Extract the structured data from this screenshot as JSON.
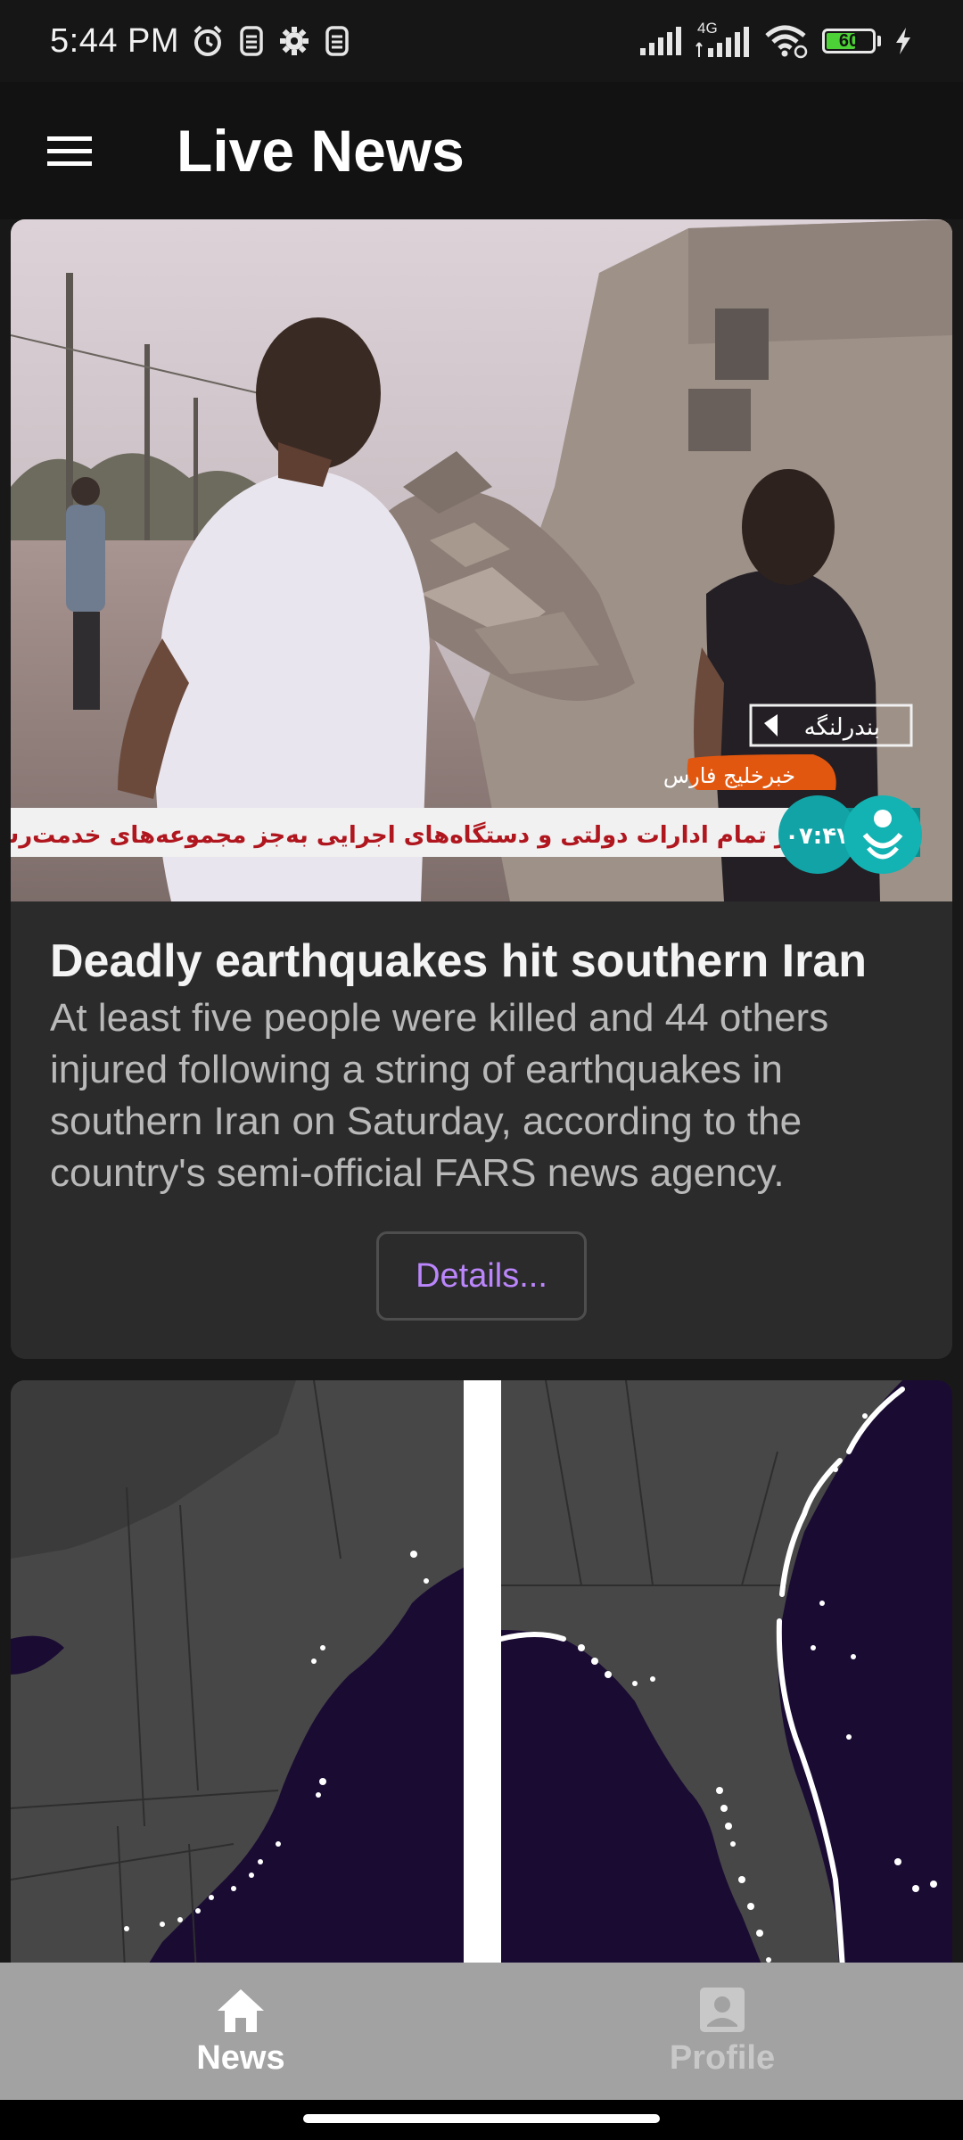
{
  "status_bar": {
    "time": "5:44 PM",
    "network_label": "4G",
    "battery_level": "60",
    "icons": [
      "alarm-icon",
      "sim-icon",
      "settings-icon",
      "sim-icon",
      "signal-icon",
      "signal-4g-icon",
      "wifi-icon",
      "battery-icon",
      "charging-icon"
    ]
  },
  "app_bar": {
    "title": "Live News",
    "menu_icon": "menu-icon"
  },
  "articles": [
    {
      "title": "Deadly earthquakes hit southern Iran",
      "description": "At least five people were killed and 44 others injured following a string of earthquakes in southern Iran on Saturday, according to the country's semi-official FARS news agency.",
      "details_label": "Details...",
      "image": {
        "place_label": "بندرلنگه",
        "channel_label": "خبرخلیج فارس",
        "ticker": "وز تمام ادارات دولتی و دستگاه‌های اجرایی به‌جز مجموعه‌های خدمت‌رسان تعطیل هست",
        "clock": "۰۷:۴۷"
      }
    },
    {
      "title": "",
      "description": "",
      "image": {
        "type": "map"
      }
    }
  ],
  "bottom_nav": {
    "items": [
      {
        "label": "News",
        "icon": "home-icon",
        "active": true
      },
      {
        "label": "Profile",
        "icon": "profile-icon",
        "active": false
      }
    ]
  },
  "colors": {
    "accent": "#bb86fc",
    "card": "#2b2b2b",
    "app_bar": "#121212",
    "bottom_nav": "#a2a2a2",
    "map_water": "#1a0b33",
    "map_land": "#474747"
  }
}
